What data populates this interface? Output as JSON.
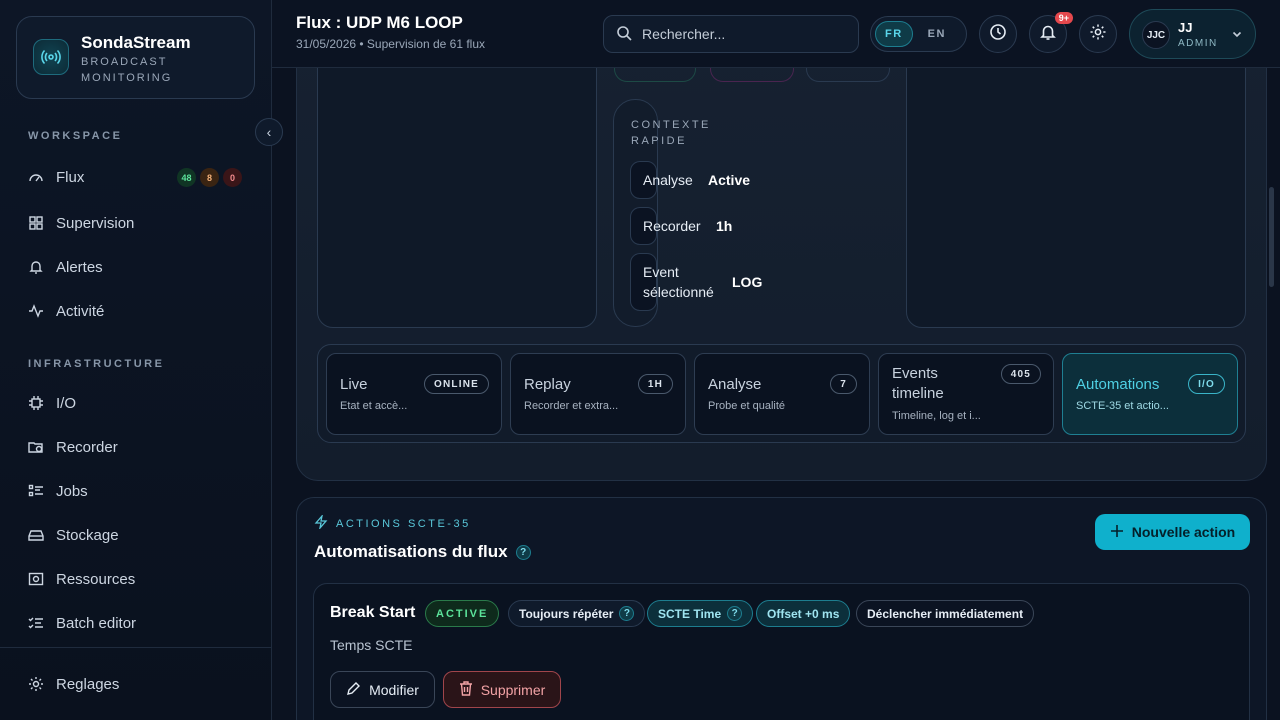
{
  "brand": {
    "name": "SondaStream",
    "subtitle": "BROADCAST MONITORING"
  },
  "sidebar": {
    "workspace_label": "WORKSPACE",
    "infrastructure_label": "INFRASTRUCTURE",
    "workspace_items": [
      {
        "label": "Flux",
        "icon": "gauge-icon",
        "badges": [
          "48",
          "8",
          "0"
        ]
      },
      {
        "label": "Supervision",
        "icon": "dashboard-icon"
      },
      {
        "label": "Alertes",
        "icon": "bell-icon"
      },
      {
        "label": "Activité",
        "icon": "activity-icon"
      }
    ],
    "infrastructure_items": [
      {
        "label": "I/O",
        "icon": "chip-icon"
      },
      {
        "label": "Recorder",
        "icon": "folder-clock-icon"
      },
      {
        "label": "Jobs",
        "icon": "list-icon"
      },
      {
        "label": "Stockage",
        "icon": "drive-icon"
      },
      {
        "label": "Ressources",
        "icon": "server-icon"
      },
      {
        "label": "Batch editor",
        "icon": "checklist-icon"
      }
    ],
    "footer_item": {
      "label": "Reglages",
      "icon": "gear-icon"
    }
  },
  "header": {
    "title": "Flux : UDP M6 LOOP",
    "subtitle": "31/05/2026 • Supervision de 61 flux",
    "search_placeholder": "Rechercher...",
    "lang_fr": "FR",
    "lang_en": "EN",
    "notif_count": "9+",
    "user_initials": "JJC",
    "user_name": "JJ",
    "user_role": "ADMIN"
  },
  "context": {
    "title": "CONTEXTE RAPIDE",
    "rows": [
      {
        "label": "Analyse",
        "value": "Active"
      },
      {
        "label": "Recorder",
        "value": "1h"
      },
      {
        "label": "Event sélectionné",
        "value": "LOG"
      }
    ]
  },
  "tabs": [
    {
      "title": "Live",
      "desc": "Etat et accè...",
      "badge": "ONLINE",
      "active": false
    },
    {
      "title": "Replay",
      "desc": "Recorder et extra...",
      "badge": "1H",
      "active": false
    },
    {
      "title": "Analyse",
      "desc": "Probe et qualité",
      "badge": "7",
      "active": false
    },
    {
      "title": "Events timeline",
      "desc": "Timeline, log et i...",
      "badge": "405",
      "active": false
    },
    {
      "title": "Automations",
      "desc": "SCTE-35 et actio...",
      "badge": "I/O",
      "active": true
    }
  ],
  "automations": {
    "kicker": "ACTIONS SCTE-35",
    "title": "Automatisations du flux",
    "new_action_label": "Nouvelle action",
    "action": {
      "name": "Break Start",
      "status": "ACTIVE",
      "repeat": "Toujours répéter",
      "time": "SCTE Time",
      "offset": "Offset +0 ms",
      "trigger": "Déclencher immédiatement",
      "description": "Temps SCTE",
      "edit_label": "Modifier",
      "delete_label": "Supprimer"
    }
  },
  "help_glyph": "?",
  "colors": {
    "accent": "#0fb0cc",
    "success": "#3ddc84",
    "danger": "#e5484d"
  }
}
